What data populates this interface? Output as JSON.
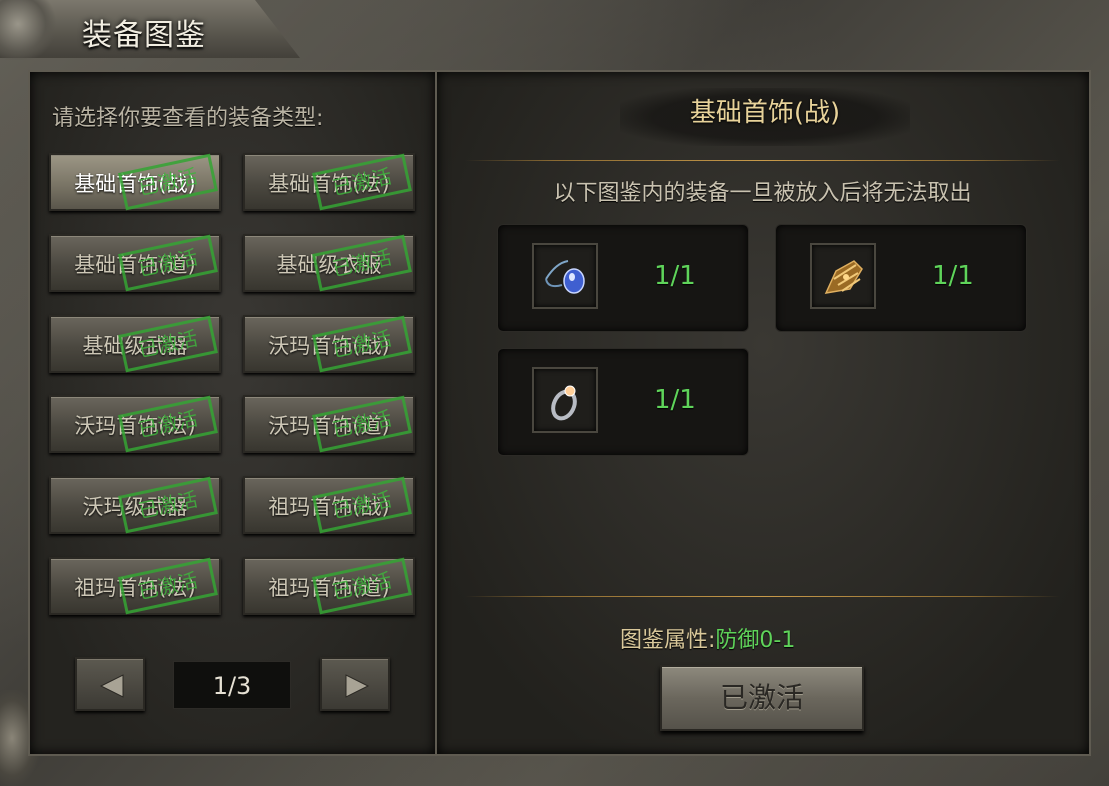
{
  "window": {
    "title": "装备图鉴"
  },
  "left": {
    "prompt": "请选择你要查看的装备类型:",
    "categories": [
      {
        "label": "基础首饰(战)",
        "stamp": "已激活",
        "selected": true
      },
      {
        "label": "基础首饰(法)",
        "stamp": "已激活",
        "selected": false
      },
      {
        "label": "基础首饰(道)",
        "stamp": "已激活",
        "selected": false
      },
      {
        "label": "基础级衣服",
        "stamp": "已激活",
        "selected": false
      },
      {
        "label": "基础级武器",
        "stamp": "已激活",
        "selected": false
      },
      {
        "label": "沃玛首饰(战)",
        "stamp": "已激活",
        "selected": false
      },
      {
        "label": "沃玛首饰(法)",
        "stamp": "已激活",
        "selected": false
      },
      {
        "label": "沃玛首饰(道)",
        "stamp": "已激活",
        "selected": false
      },
      {
        "label": "沃玛级武器",
        "stamp": "已激活",
        "selected": false
      },
      {
        "label": "祖玛首饰(战)",
        "stamp": "已激活",
        "selected": false
      },
      {
        "label": "祖玛首饰(法)",
        "stamp": "已激活",
        "selected": false
      },
      {
        "label": "祖玛首饰(道)",
        "stamp": "已激活",
        "selected": false
      }
    ],
    "pager": {
      "page": "1/3",
      "prev_icon": "left-triangle-icon",
      "next_icon": "right-triangle-icon"
    }
  },
  "right": {
    "set_title": "基础首饰(战)",
    "notice": "以下图鉴内的装备一旦被放入后将无法取出",
    "items": [
      {
        "icon": "necklace-icon",
        "count": "1/1"
      },
      {
        "icon": "bracelet-icon",
        "count": "1/1"
      },
      {
        "icon": "ring-icon",
        "count": "1/1"
      }
    ],
    "attribute_label": "图鉴属性:",
    "attribute_value": "防御0-1",
    "activate_button": "已激活"
  },
  "colors": {
    "count_green": "#5fd35a",
    "title_gold": "#e8d39a",
    "stamp_green": "#3fb43d"
  }
}
